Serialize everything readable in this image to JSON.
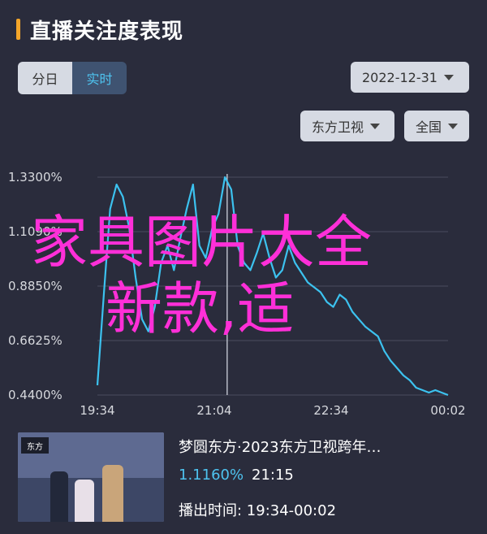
{
  "header": {
    "title": "直播关注度表现"
  },
  "toggle": {
    "daily": "分日",
    "realtime": "实时",
    "selected": "realtime"
  },
  "filters": {
    "date": "2022-12-31",
    "channel": "东方卫视",
    "region": "全国"
  },
  "colors": {
    "accent": "#f3a52a",
    "line": "#3cc2ef",
    "overlay": "#ff2fd8",
    "background": "#2a2c3c"
  },
  "overlay": {
    "line1": "家具图片大全",
    "line2": "新款,适"
  },
  "chart_data": {
    "type": "line",
    "y_ticks": [
      "1.3300%",
      "1.1090%",
      "0.8850%",
      "0.6625%",
      "0.4400%"
    ],
    "x_ticks": [
      "19:34",
      "21:04",
      "22:34",
      "00:02"
    ],
    "ylim": [
      0.44,
      1.33
    ],
    "grid": true,
    "marker_time": "21:15",
    "series": [
      {
        "values": [
          0.48,
          0.85,
          1.2,
          1.3,
          1.25,
          1.12,
          0.92,
          0.75,
          0.7,
          0.8,
          0.98,
          1.05,
          0.95,
          1.08,
          1.2,
          1.3,
          1.05,
          1.0,
          1.12,
          1.18,
          1.33,
          1.28,
          1.05,
          0.98,
          0.95,
          1.02,
          1.1,
          1.0,
          0.92,
          0.95,
          1.05,
          0.98,
          0.94,
          0.9,
          0.88,
          0.86,
          0.82,
          0.8,
          0.85,
          0.83,
          0.78,
          0.75,
          0.72,
          0.7,
          0.68,
          0.62,
          0.58,
          0.55,
          0.52,
          0.5,
          0.47,
          0.46,
          0.45,
          0.46,
          0.45,
          0.44
        ]
      }
    ]
  },
  "program": {
    "title": "梦圆东方·2023东方卫视跨年…",
    "rate": "1.1160%",
    "time": "21:15",
    "air_label": "播出时间: 19:34-00:02",
    "thumb_logo": "东方"
  }
}
